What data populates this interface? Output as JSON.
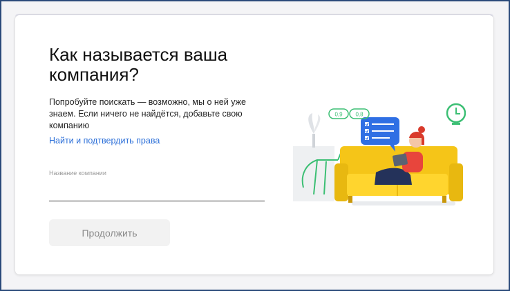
{
  "form": {
    "title": "Как называется ваша компания?",
    "description": "Попробуйте поискать — возможно, мы о ней уже знаем. Если ничего не найдётся, добавьте свою компанию",
    "find_link": "Найти и подтвердить права",
    "field_label": "Название компании",
    "field_value": "",
    "continue_label": "Продолжить"
  },
  "illustration": {
    "rating_1": "0,9",
    "rating_2": "0,8",
    "icons": [
      "clock-icon",
      "checklist-bubble-icon",
      "rating-badge-icon"
    ]
  },
  "colors": {
    "link": "#2a6ed8",
    "sofa": "#f5c518",
    "accent_green": "#3cbf74",
    "bubble": "#2f6fe4",
    "person_top": "#e8453c"
  }
}
